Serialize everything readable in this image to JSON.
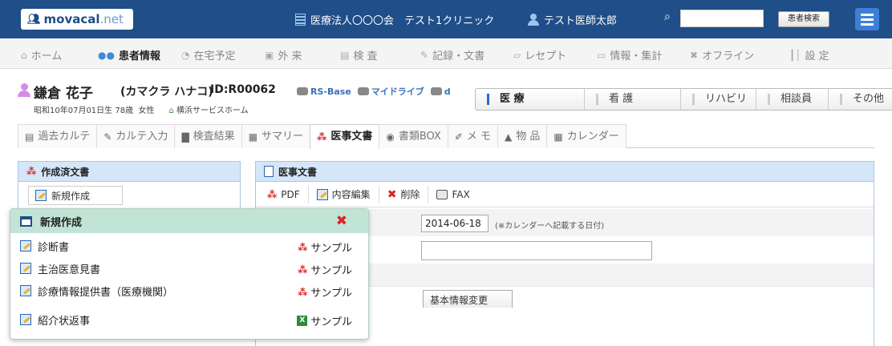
{
  "topbar": {
    "logo_main": "movacal",
    "logo_suffix": ".net",
    "organization": "医療法人〇〇〇会　テスト1クリニック",
    "doctor": "テスト医師太郎",
    "search_placeholder": "",
    "search_button": "患者検索",
    "colors": {
      "bar": "#1f4e89",
      "menu_button": "#3d7fd6"
    }
  },
  "mainnav": {
    "items": [
      {
        "label": "ホーム",
        "icon": "home-icon"
      },
      {
        "label": "患者情報",
        "icon": "people-icon",
        "active": true
      },
      {
        "label": "在宅予定",
        "icon": "clock-icon"
      },
      {
        "label": "外 来",
        "icon": "clinic-icon"
      },
      {
        "label": "検 査",
        "icon": "chart-icon"
      },
      {
        "label": "記録・文書",
        "icon": "document-icon"
      },
      {
        "label": "レセプト",
        "icon": "receipt-icon"
      },
      {
        "label": "情報・集計",
        "icon": "monitor-icon"
      },
      {
        "label": "オフライン",
        "icon": "offline-icon"
      },
      {
        "label": "設 定",
        "icon": "settings-icon"
      }
    ]
  },
  "patient": {
    "name": "鎌倉 花子",
    "kana": "(カマクラ ハナコ)",
    "id": "ID:R00062",
    "links": [
      "RS-Base",
      "マイドライブ",
      "d"
    ],
    "birth": "昭和10年07月01日生 78歳",
    "sex": "女性",
    "facility": "横浜サービスホーム"
  },
  "role_tabs": [
    {
      "label": "医 療",
      "active": true
    },
    {
      "label": "看 護"
    },
    {
      "label": "リハビリ"
    },
    {
      "label": "相談員"
    },
    {
      "label": "その他"
    }
  ],
  "subtabs": [
    {
      "label": "過去カルテ",
      "icon": "history-icon"
    },
    {
      "label": "カルテ入力",
      "icon": "edit-icon"
    },
    {
      "label": "検査結果",
      "icon": "bar-chart-icon"
    },
    {
      "label": "サマリー",
      "icon": "summary-icon"
    },
    {
      "label": "医事文書",
      "icon": "pdf-icon",
      "active": true
    },
    {
      "label": "書類BOX",
      "icon": "box-icon"
    },
    {
      "label": "メ モ",
      "icon": "memo-icon"
    },
    {
      "label": "物 品",
      "icon": "goods-icon"
    },
    {
      "label": "カレンダー",
      "icon": "calendar-icon"
    }
  ],
  "left_panel": {
    "title": "作成済文書",
    "new_button": "新規作成"
  },
  "right_panel": {
    "title": "医事文書",
    "toolbar": {
      "pdf": "PDF",
      "edit": "内容編集",
      "delete": "削除",
      "fax": "FAX"
    },
    "date_value": "2014-06-18",
    "date_note": "(※カレンダーへ記載する日付)",
    "text_value": "",
    "basic_info_button": "基本情報変更"
  },
  "popup": {
    "title": "新規作成",
    "items": [
      {
        "label": "診断書",
        "sample": "サンプル",
        "sample_icon": "pdf-icon"
      },
      {
        "label": "主治医意見書",
        "sample": "サンプル",
        "sample_icon": "pdf-icon"
      },
      {
        "label": "診療情報提供書（医療機関）",
        "sample": "サンプル",
        "sample_icon": "pdf-icon"
      },
      {
        "label": "紹介状返事",
        "sample": "サンプル",
        "sample_icon": "excel-icon"
      }
    ]
  }
}
